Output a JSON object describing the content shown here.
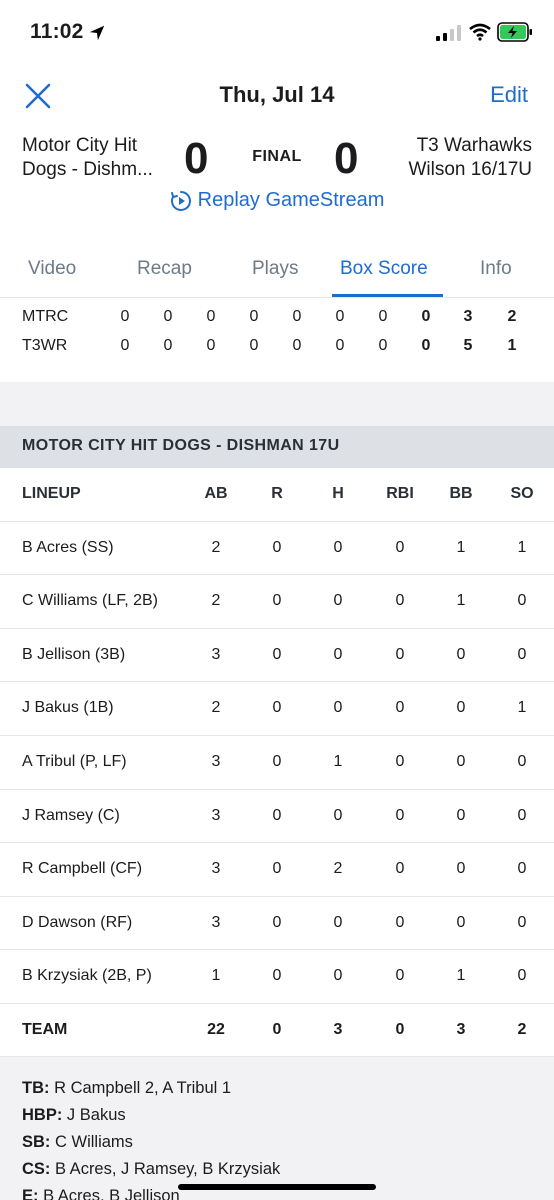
{
  "status": {
    "time": "11:02"
  },
  "nav": {
    "title": "Thu, Jul 14",
    "edit": "Edit"
  },
  "game": {
    "home_team_line1": "Motor City Hit",
    "home_team_line2": "Dogs - Dishm...",
    "home_score": "0",
    "status": "FINAL",
    "away_score": "0",
    "away_team_line1": "T3 Warhawks",
    "away_team_line2": "Wilson 16/17U",
    "replay": "Replay GameStream"
  },
  "tabs": [
    "Video",
    "Recap",
    "Plays",
    "Box Score",
    "Info"
  ],
  "active_tab": "Box Score",
  "line_score": [
    {
      "team": "MTRC",
      "innings": [
        "0",
        "0",
        "0",
        "0",
        "0",
        "0",
        "0"
      ],
      "r": "0",
      "h": "3",
      "e": "2"
    },
    {
      "team": "T3WR",
      "innings": [
        "0",
        "0",
        "0",
        "0",
        "0",
        "0",
        "0"
      ],
      "r": "0",
      "h": "5",
      "e": "1"
    }
  ],
  "section_title": "MOTOR CITY HIT DOGS - DISHMAN 17U",
  "box_headers": [
    "LINEUP",
    "AB",
    "R",
    "H",
    "RBI",
    "BB",
    "SO"
  ],
  "box_rows": [
    [
      "B Acres (SS)",
      "2",
      "0",
      "0",
      "0",
      "1",
      "1"
    ],
    [
      "C Williams (LF, 2B)",
      "2",
      "0",
      "0",
      "0",
      "1",
      "0"
    ],
    [
      "B Jellison (3B)",
      "3",
      "0",
      "0",
      "0",
      "0",
      "0"
    ],
    [
      "J Bakus (1B)",
      "2",
      "0",
      "0",
      "0",
      "0",
      "1"
    ],
    [
      "A Tribul (P, LF)",
      "3",
      "0",
      "1",
      "0",
      "0",
      "0"
    ],
    [
      "J Ramsey (C)",
      "3",
      "0",
      "0",
      "0",
      "0",
      "0"
    ],
    [
      "R Campbell (CF)",
      "3",
      "0",
      "2",
      "0",
      "0",
      "0"
    ],
    [
      "D Dawson (RF)",
      "3",
      "0",
      "0",
      "0",
      "0",
      "0"
    ],
    [
      "B Krzysiak (2B, P)",
      "1",
      "0",
      "0",
      "0",
      "1",
      "0"
    ]
  ],
  "box_total": [
    "TEAM",
    "22",
    "0",
    "3",
    "0",
    "3",
    "2"
  ],
  "notes": [
    {
      "label": "TB:",
      "text": " R Campbell 2, A Tribul 1"
    },
    {
      "label": "HBP:",
      "text": " J Bakus"
    },
    {
      "label": "SB:",
      "text": " C Williams"
    },
    {
      "label": "CS:",
      "text": " B Acres, J Ramsey, B Krzysiak"
    },
    {
      "label": "E:",
      "text": " B Acres, B Jellison"
    }
  ],
  "colors": {
    "accent": "#1f6ccf",
    "battery": "#34c759"
  },
  "icons": [
    "location-arrow-icon",
    "signal-icon",
    "wifi-icon",
    "battery-charging-icon",
    "close-icon",
    "replay-icon"
  ]
}
